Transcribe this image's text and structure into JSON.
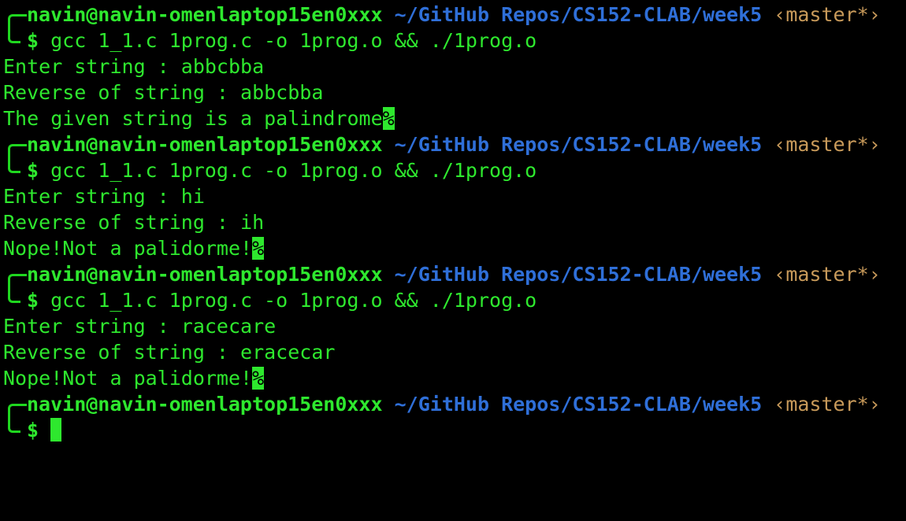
{
  "terminal": {
    "blocks": [
      {
        "user_host": "navin@navin-omenlaptop15en0xxx",
        "path": "~/GitHub Repos/CS152-CLAB/week5",
        "git": "‹master*›",
        "dollar": "$",
        "command": "gcc 1_1.c 1prog.c -o 1prog.o && ./1prog.o",
        "out1": "Enter string : abbcbba",
        "out2": "Reverse of string : abbcbba",
        "out3": "The given string is a palindrome",
        "pct": "%"
      },
      {
        "user_host": "navin@navin-omenlaptop15en0xxx",
        "path": "~/GitHub Repos/CS152-CLAB/week5",
        "git": "‹master*›",
        "dollar": "$",
        "command": "gcc 1_1.c 1prog.c -o 1prog.o && ./1prog.o",
        "out1": "Enter string : hi",
        "out2": "Reverse of string : ih",
        "out3": "Nope!Not a palidorme!",
        "pct": "%"
      },
      {
        "user_host": "navin@navin-omenlaptop15en0xxx",
        "path": "~/GitHub Repos/CS152-CLAB/week5",
        "git": "‹master*›",
        "dollar": "$",
        "command": "gcc 1_1.c 1prog.c -o 1prog.o && ./1prog.o",
        "out1": "Enter string : racecare",
        "out2": "Reverse of string : eracecar",
        "out3": "Nope!Not a palidorme!",
        "pct": "%"
      }
    ],
    "final_prompt": {
      "user_host": "navin@navin-omenlaptop15en0xxx",
      "path": "~/GitHub Repos/CS152-CLAB/week5",
      "git": "‹master*›",
      "dollar": "$"
    }
  }
}
